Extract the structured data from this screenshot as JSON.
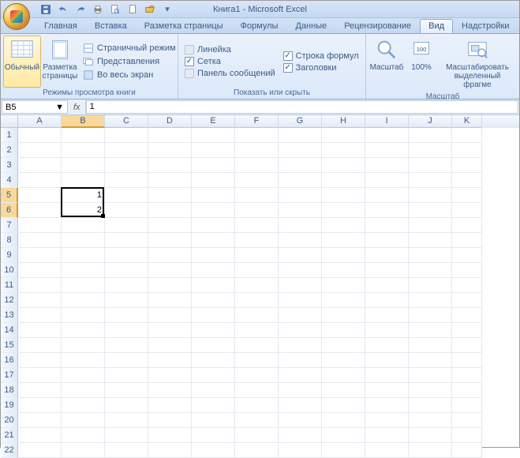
{
  "title": "Книга1 - Microsoft Excel",
  "tabs": [
    "Главная",
    "Вставка",
    "Разметка страницы",
    "Формулы",
    "Данные",
    "Рецензирование",
    "Вид",
    "Надстройки"
  ],
  "active_tab": "Вид",
  "ribbon": {
    "views": {
      "normal": "Обычный",
      "page": "Разметка\nстраницы",
      "page_layout": "Страничный режим",
      "custom": "Представления",
      "full": "Во весь экран",
      "group": "Режимы просмотра книги"
    },
    "show": {
      "ruler": "Линейка",
      "grid": "Сетка",
      "messages": "Панель сообщений",
      "formula": "Строка формул",
      "headings": "Заголовки",
      "group": "Показать или скрыть"
    },
    "zoom": {
      "zoom": "Масштаб",
      "hundred": "100%",
      "sel": "Масштабировать выделенный фрагме",
      "group": "Масштаб"
    }
  },
  "namebox": "B5",
  "formula": "1",
  "columns": [
    "A",
    "B",
    "C",
    "D",
    "E",
    "F",
    "G",
    "H",
    "I",
    "J",
    "K"
  ],
  "rows_visible": 22,
  "selected_cols": [
    "B"
  ],
  "selected_rows": [
    5,
    6
  ],
  "cells": {
    "B5": "1",
    "B6": "2"
  },
  "selection": {
    "col": "B",
    "row_from": 5,
    "row_to": 6
  }
}
